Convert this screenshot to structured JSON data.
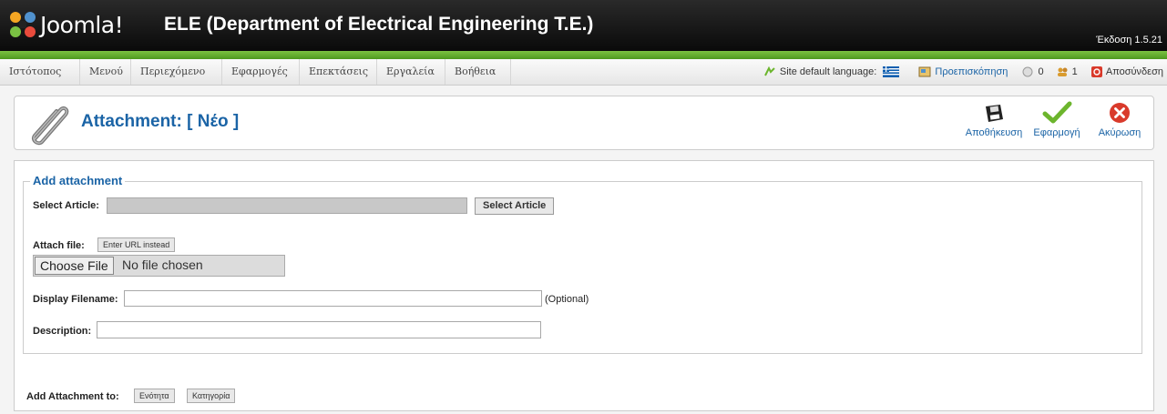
{
  "header": {
    "logo_text": "Joomla!",
    "site_title": "ELE (Department of Electrical Engineering T.E.)",
    "version": "Έκδοση 1.5.21"
  },
  "menu": {
    "items": [
      "Ιστότοπος",
      "Μενού",
      "Περιεχόμενο",
      "Εφαρμογές",
      "Επεκτάσεις",
      "Εργαλεία",
      "Βοήθεια"
    ]
  },
  "status": {
    "language_label": "Site default language:",
    "preview": "Προεπισκόπηση",
    "messages_count": "0",
    "users_count": "1",
    "logout": "Αποσύνδεση"
  },
  "toolbar": {
    "title": "Attachment: [ Νέο ]",
    "save": "Αποθήκευση",
    "apply": "Εφαρμογή",
    "cancel": "Ακύρωση"
  },
  "form": {
    "legend": "Add attachment",
    "select_article_label": "Select Article:",
    "select_article_button": "Select Article",
    "attach_file_label": "Attach file:",
    "enter_url_button": "Enter URL instead",
    "choose_file_button": "Choose File",
    "file_status": "No file chosen",
    "display_filename_label": "Display Filename:",
    "optional_hint": "(Optional)",
    "description_label": "Description:",
    "add_to_label": "Add Attachment to:",
    "add_to_buttons": [
      "Ενότητα",
      "Κατηγορία"
    ]
  },
  "colors": {
    "accent_green": "#6cb52d",
    "title_blue": "#1b64a6",
    "cancel_red": "#d93a2b"
  }
}
